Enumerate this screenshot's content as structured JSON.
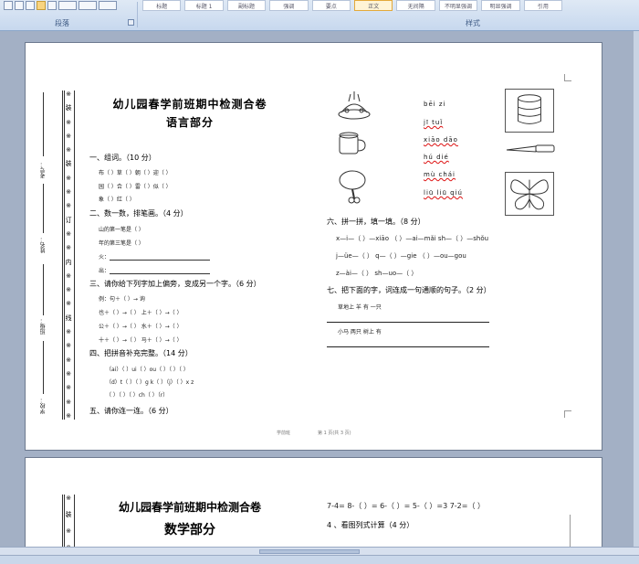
{
  "ribbon": {
    "paragraph_group_label": "段落",
    "styles_group_label": "样式",
    "style_chips": [
      "标题",
      "标题 1",
      "副标题",
      "强调",
      "要点",
      "正文",
      "无间隔",
      "不明显强调",
      "明显强调",
      "引用"
    ],
    "selected_style_index": 5
  },
  "page1": {
    "binding_chars": [
      "※",
      "装",
      "※",
      "※",
      "※",
      "装",
      "※",
      "※",
      "※",
      "订",
      "※",
      "※",
      "内",
      "※",
      "※",
      "※",
      "线",
      "※",
      "※",
      "※",
      "※",
      "※",
      "※",
      "※"
    ],
    "info_labels": [
      "学校：",
      "班级：",
      "姓名：",
      "考号："
    ],
    "title_line1": "幼儿园春学前班期中检测合卷",
    "title_line2": "语言部分",
    "q1": {
      "heading": "一、组词。（10 分）",
      "rows": [
        "布（      ）草（      ）朝（      ）迎（      ）",
        "园（      ）合（      ）雷（      ）似（      ）",
        "象（      ）红（      ）"
      ]
    },
    "q2": {
      "heading": "二、数一数，排笔画。（4 分）",
      "rows": [
        "山的第一笔是（      ）",
        "年的第三笔是（      ）",
        "火：",
        "出："
      ]
    },
    "q3": {
      "heading": "三、请你给下列字加上偏旁，变成另一个字。（6 分）",
      "rows": [
        "例：句＋（   ）→ 询",
        "也＋（   ）→（      ）        上＋（   ）→（      ）",
        "公＋（   ）→（      ）        水＋（   ）→（      ）",
        "十＋（   ）→（      ）        马＋（   ）→（      ）"
      ]
    },
    "q4": {
      "heading": "四、把拼音补充完整。（14 分）",
      "rows": [
        "（ai）（   ）ui（   ）ou（   ）（   ）（   ）",
        "（d）t（   ）（   ）g  k（   ）（j）（   ）x     z",
        "（   ）（   ）（   ）ch（   ）（r）"
      ]
    },
    "q5": {
      "heading": "五、请你连一连。（6 分）"
    },
    "pinyin_words": [
      "bēi  zi",
      "jī  tuǐ",
      "xiāo dāo",
      "hú  dié",
      "mù  chái",
      "liū liū qiú"
    ],
    "q6": {
      "heading": "六、拼一拼，填一填。（8 分）",
      "rows": [
        "x—i—（    ）—xiāo        （    ）—ai—mǎi        sh—（    ）—shǒu",
        "j—üe—（    ）            q—（    ）—gie              （    ）—ou—gou",
        "z—ài—（    ）            sh—uo—（    ）"
      ]
    },
    "q7": {
      "heading": "七、把下面的字，词连成一句通顺的句子。（2 分）",
      "row1": "草地上    羊    有    一只",
      "row2": "小马    两只    树上    有"
    },
    "footer_left": "学前班",
    "footer_right": "第 1 页(共 3 页)"
  },
  "page2": {
    "title_line1": "幼儿园春学前班期中检测合卷",
    "title_line2": "数学部分",
    "math_row": "7-4=     8-（  ）=     6-（  ）=     5-（  ）=3     7-2=（  ）",
    "q4_heading": "4 、看图列式计算（4 分）"
  }
}
